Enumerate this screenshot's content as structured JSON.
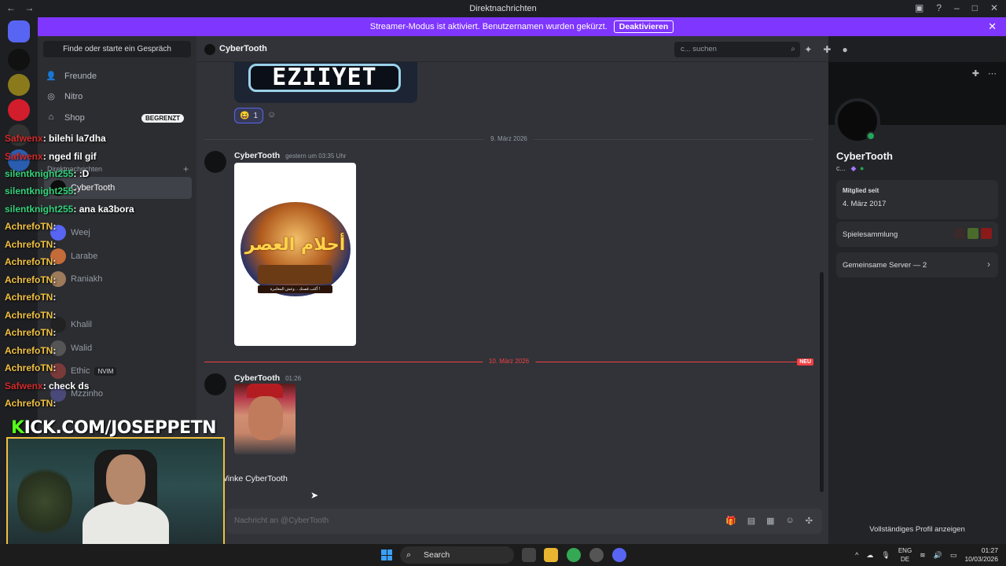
{
  "window": {
    "title": "Direktnachrichten"
  },
  "banner": {
    "text": "Streamer-Modus ist aktiviert. Benutzernamen wurden gekürzt.",
    "button": "Deaktivieren"
  },
  "sidebar": {
    "find_label": "Finde oder starte ein Gespräch",
    "nav": [
      {
        "label": "Freunde",
        "icon": "friends-icon"
      },
      {
        "label": "Nitro",
        "icon": "nitro-icon"
      },
      {
        "label": "Shop",
        "icon": "shop-icon",
        "badge": "BEGRENZT"
      }
    ],
    "section_label": "Direktnachrichten",
    "dms": [
      {
        "label": "CyberTooth",
        "selected": true
      },
      {
        "label": "Weej"
      },
      {
        "label": "Larabe"
      },
      {
        "label": "Raniakh"
      },
      {
        "label": "Khalil"
      },
      {
        "label": "Walid"
      },
      {
        "label": "Ethic",
        "tag": "NVIM"
      },
      {
        "label": "Mzzinho"
      }
    ]
  },
  "chat": {
    "recipient": "CyberTooth",
    "search_placeholder": "c... suchen",
    "embed_text": "EZIIYET",
    "reaction": {
      "emoji": "😆",
      "count": "1"
    },
    "date1": "9. März 2026",
    "msg1": {
      "author": "CyberTooth",
      "time": "gestern um 03:35 Uhr"
    },
    "poster_title": "أحلام العصر",
    "poster_band": "أكتب قصتك .. وعش المغامرة !",
    "date2": "10. März 2026",
    "new_badge": "NEU",
    "msg2": {
      "author": "CyberTooth",
      "time": "01:26"
    },
    "wave_label": "Winke CyberTooth",
    "composer_placeholder": "Nachricht an @CyberTooth"
  },
  "profile": {
    "name": "CyberTooth",
    "handle": "c...",
    "member_since_label": "Mitglied seit",
    "member_since": "4. März 2017",
    "games_label": "Spielesammlung",
    "servers_label": "Gemeinsame Server — 2",
    "full_profile": "Vollständiges Profil anzeigen"
  },
  "overlay": {
    "kick": {
      "prefix": "K",
      "rest": "ICK.COM/JOSEPPETN"
    },
    "messages": [
      {
        "user": "Safwenx",
        "text": ": bilehi la7dha",
        "color": "red"
      },
      {
        "user": "Safwenx",
        "text": ": nged fil gif",
        "color": "red"
      },
      {
        "user": "silentknight255",
        "text": ": :D",
        "color": "green"
      },
      {
        "user": "silentknight255",
        "text": ":",
        "color": "green"
      },
      {
        "user": "silentknight255",
        "text": ": ana ka3bora",
        "color": "green"
      },
      {
        "user": "AchrefoTN",
        "text": ":",
        "color": "yellow"
      },
      {
        "user": "AchrefoTN",
        "text": ":",
        "color": "yellow"
      },
      {
        "user": "AchrefoTN",
        "text": ":",
        "color": "yellow"
      },
      {
        "user": "AchrefoTN",
        "text": ":",
        "color": "yellow"
      },
      {
        "user": "AchrefoTN",
        "text": ":",
        "color": "yellow"
      },
      {
        "user": "AchrefoTN",
        "text": ":",
        "color": "yellow"
      },
      {
        "user": "AchrefoTN",
        "text": ":",
        "color": "yellow"
      },
      {
        "user": "AchrefoTN",
        "text": ":",
        "color": "yellow"
      },
      {
        "user": "AchrefoTN",
        "text": ":",
        "color": "yellow"
      },
      {
        "user": "Safwenx",
        "text": ": check ds",
        "color": "red"
      },
      {
        "user": "AchrefoTN",
        "text": ":",
        "color": "yellow"
      }
    ]
  },
  "taskbar": {
    "search_label": "Search",
    "lang_top": "ENG",
    "lang_bottom": "DE",
    "time": "01:27",
    "date": "10/03/2026"
  },
  "colors": {
    "accent": "#7f36ff",
    "blurple": "#5865f2",
    "online": "#23a55a",
    "new_red": "#f23f43"
  }
}
